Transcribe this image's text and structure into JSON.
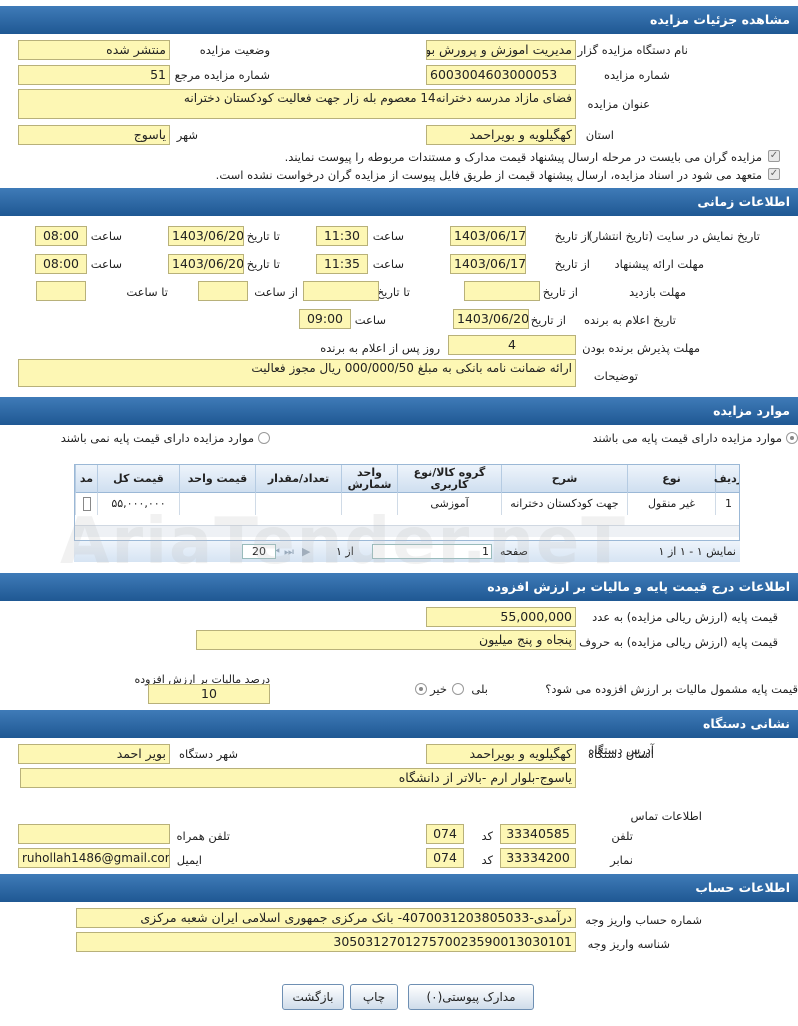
{
  "s1": {
    "title": "مشاهده جزئیات مزایده",
    "org_label": "نام دستگاه مزایده گزار",
    "org": "مدیریت اموزش و پرورش بوی",
    "status_label": "وضعیت مزایده",
    "status": "منتشر شده",
    "num_label": "شماره مزایده",
    "num": "6003004603000053",
    "ref_label": "شماره مزایده مرجع",
    "ref": "51",
    "subject_label": "عنوان مزایده",
    "subject": "فضای  مازاد مدرسه دخترانه14 معصوم بله زار جهت فعالیت کودکستان دخترانه",
    "province_label": "استان",
    "province": "کهگیلویه و بویراحمد",
    "city_label": "شهر",
    "city": "یاسوج",
    "chk1": "مزایده گران می بایست در مرحله ارسال پیشنهاد قیمت مدارک و مستندات مربوطه را پیوست نمایند.",
    "chk2": "متعهد می شود در اسناد مزایده، ارسال پیشنهاد قیمت از طریق فایل پیوست از مزایده گران درخواست نشده است."
  },
  "s2": {
    "title": "اطلاعات زمانی",
    "r1_label": "تاریخ نمایش در سایت (تاریخ انتشار)",
    "r2_label": "مهلت ارائه پیشنهاد",
    "r3_label": "مهلت بازدید",
    "from_date": "از تاریخ",
    "time": "ساعت",
    "to_date": "تا تاریخ",
    "to_time": "تا ساعت",
    "r1_from": "1403/06/17",
    "r1_time": "11:30",
    "r1_to": "1403/06/20",
    "r1_totime": "08:00",
    "r2_from": "1403/06/17",
    "r2_time": "11:35",
    "r2_to": "1403/06/20",
    "r2_totime": "08:00",
    "r4_label": "تاریخ اعلام به برنده",
    "r4_date": "1403/06/20",
    "r4_time": "09:00",
    "r5_label": "مهلت پذیرش برنده بودن",
    "r5_val": "4",
    "r5_suffix": "روز پس از اعلام به برنده",
    "desc_label": "توضیحات",
    "desc": "ارائه ضمانت نامه بانکی به مبلغ 000/000/50 ریال مجوز فعالیت"
  },
  "s3": {
    "title": "موارد مزایده",
    "opt1": "موارد مزایده دارای قیمت پایه می باشند",
    "opt2": "موارد مزایده دارای قیمت پایه نمی باشند",
    "headers": [
      "ردیف",
      "نوع",
      "شرح",
      "گروه کالا/نوع کاربری",
      "واحد شمارش",
      "تعداد/مقدار",
      "قیمت واحد",
      "قیمت کل",
      "مد"
    ],
    "row": [
      "1",
      "غیر منقول",
      "جهت کودکستان دخترانه",
      "آموزشی",
      "",
      "",
      "",
      "۵۵,۰۰۰,۰۰۰",
      ""
    ],
    "pager_show": "نمایش ۱ - ۱ از ۱",
    "page_label": "صفحه",
    "page": "1",
    "of": "از ۱",
    "page_size": "20"
  },
  "s4": {
    "title": "اطلاعات درج قیمت پایه و مالیات بر ارزش افزوده",
    "base_num_label": "قیمت پایه (ارزش ریالی مزایده) به عدد",
    "base_num": "55,000,000",
    "base_txt_label": "قیمت پایه (ارزش ریالی مزایده) به حروف",
    "base_txt": "پنجاه و پنج میلیون",
    "vat_q": "قیمت پایه مشمول مالیات بر ارزش افزوده می شود؟",
    "yes": "بلی",
    "no": "خیر",
    "vat_label": "درصد مالیات بر ارزش افزوده",
    "vat": "10"
  },
  "s5": {
    "title": "نشانی دستگاه",
    "prov_label": "استان دستگاه",
    "prov": "کهگیلویه و بویراحمد",
    "city_label": "شهر دستگاه",
    "city": "بویر احمد",
    "addr_label": "آدرس دستگاه",
    "addr": "یاسوج-بلوار ارم -بالاتر از دانشگاه",
    "contact": "اطلاعات تماس",
    "tel_label": "تلفن",
    "tel": "33340585",
    "code_label": "کد",
    "tel_code": "074",
    "mob_label": "تلفن همراه",
    "mob": "",
    "fax_label": "نمابر",
    "fax": "33334200",
    "fax_code": "074",
    "email_label": "ایمیل",
    "email": "ruhollah1486@gmail.com"
  },
  "s6": {
    "title": "اطلاعات حساب",
    "acc_label": "شماره حساب واریز وجه",
    "acc": "درآمدی-4070031203805033- بانک مرکزی جمهوری اسلامی ایران شعبه مرکزی",
    "sheba_label": "شناسه واریز وجه",
    "sheba": "305031270127570023590013030101"
  },
  "buttons": {
    "docs": "مدارک پیوستی(۰)",
    "print": "چاپ",
    "back": "بازگشت"
  },
  "watermark": "AriaTender.neT"
}
